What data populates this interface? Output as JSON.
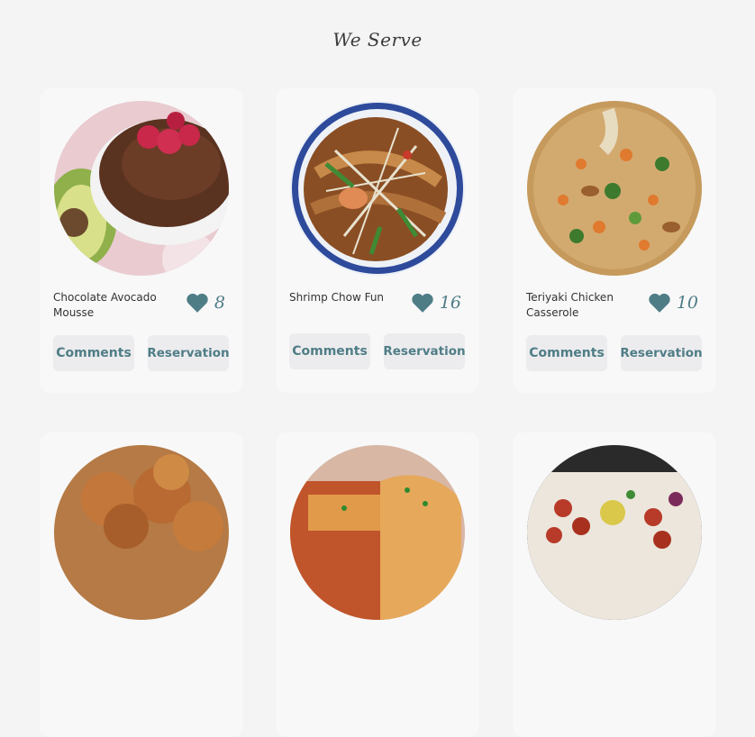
{
  "title": "We Serve",
  "accent_color": "#4f7d86",
  "dishes": [
    {
      "name": "Chocolate Avocado Mousse",
      "likes": "8",
      "comments_label": "Comments",
      "reservation_label": "Reservation"
    },
    {
      "name": "Shrimp Chow Fun",
      "likes": "16",
      "comments_label": "Comments",
      "reservation_label": "Reservation"
    },
    {
      "name": "Teriyaki Chicken Casserole",
      "likes": "10",
      "comments_label": "Comments",
      "reservation_label": "Reservation"
    }
  ],
  "icons": {
    "like": "heart-icon"
  }
}
